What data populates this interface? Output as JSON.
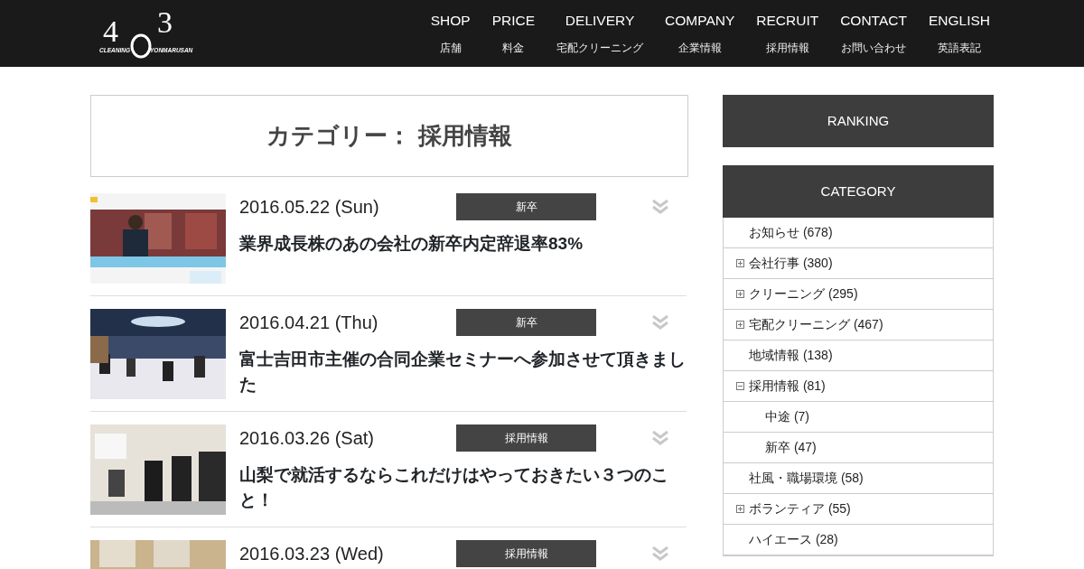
{
  "logo": {
    "digits": [
      "4",
      "3"
    ],
    "left_text": "CLEANING",
    "right_text": "YONMARUSAN"
  },
  "nav": [
    {
      "label": "SHOP",
      "sub": "店舗"
    },
    {
      "label": "PRICE",
      "sub": "料金"
    },
    {
      "label": "DELIVERY",
      "sub": "宅配クリーニング"
    },
    {
      "label": "COMPANY",
      "sub": "企業情報"
    },
    {
      "label": "RECRUIT",
      "sub": "採用情報"
    },
    {
      "label": "CONTACT",
      "sub": "お問い合わせ"
    },
    {
      "label": "ENGLISH",
      "sub": "英語表記"
    }
  ],
  "page_title": "カテゴリー： 採用情報",
  "posts": [
    {
      "date": "2016.05.22 (Sun)",
      "tag": "新卒",
      "title": "業界成長株のあの会社の新卒内定辞退率83%"
    },
    {
      "date": "2016.04.21 (Thu)",
      "tag": "新卒",
      "title": "富士吉田市主催の合同企業セミナーへ参加させて頂きました"
    },
    {
      "date": "2016.03.26 (Sat)",
      "tag": "採用情報",
      "title": "山梨で就活するならこれだけはやっておきたい３つのこと！"
    },
    {
      "date": "2016.03.23 (Wed)",
      "tag": "採用情報"
    }
  ],
  "sidebar": {
    "ranking_title": "RANKING",
    "category_title": "CATEGORY",
    "categories": [
      {
        "label": "お知らせ (678)"
      },
      {
        "label": "会社行事 (380)",
        "expanded": false
      },
      {
        "label": "クリーニング (295)",
        "expanded": false
      },
      {
        "label": "宅配クリーニング (467)",
        "expanded": false
      },
      {
        "label": "地域情報 (138)"
      },
      {
        "label": "採用情報 (81)",
        "expanded": true,
        "children": [
          {
            "label": "中途 (7)"
          },
          {
            "label": "新卒 (47)"
          }
        ]
      },
      {
        "label": "社風・職場環境 (58)"
      },
      {
        "label": "ボランティア (55)",
        "expanded": false
      },
      {
        "label": "ハイエース (28)"
      }
    ]
  }
}
